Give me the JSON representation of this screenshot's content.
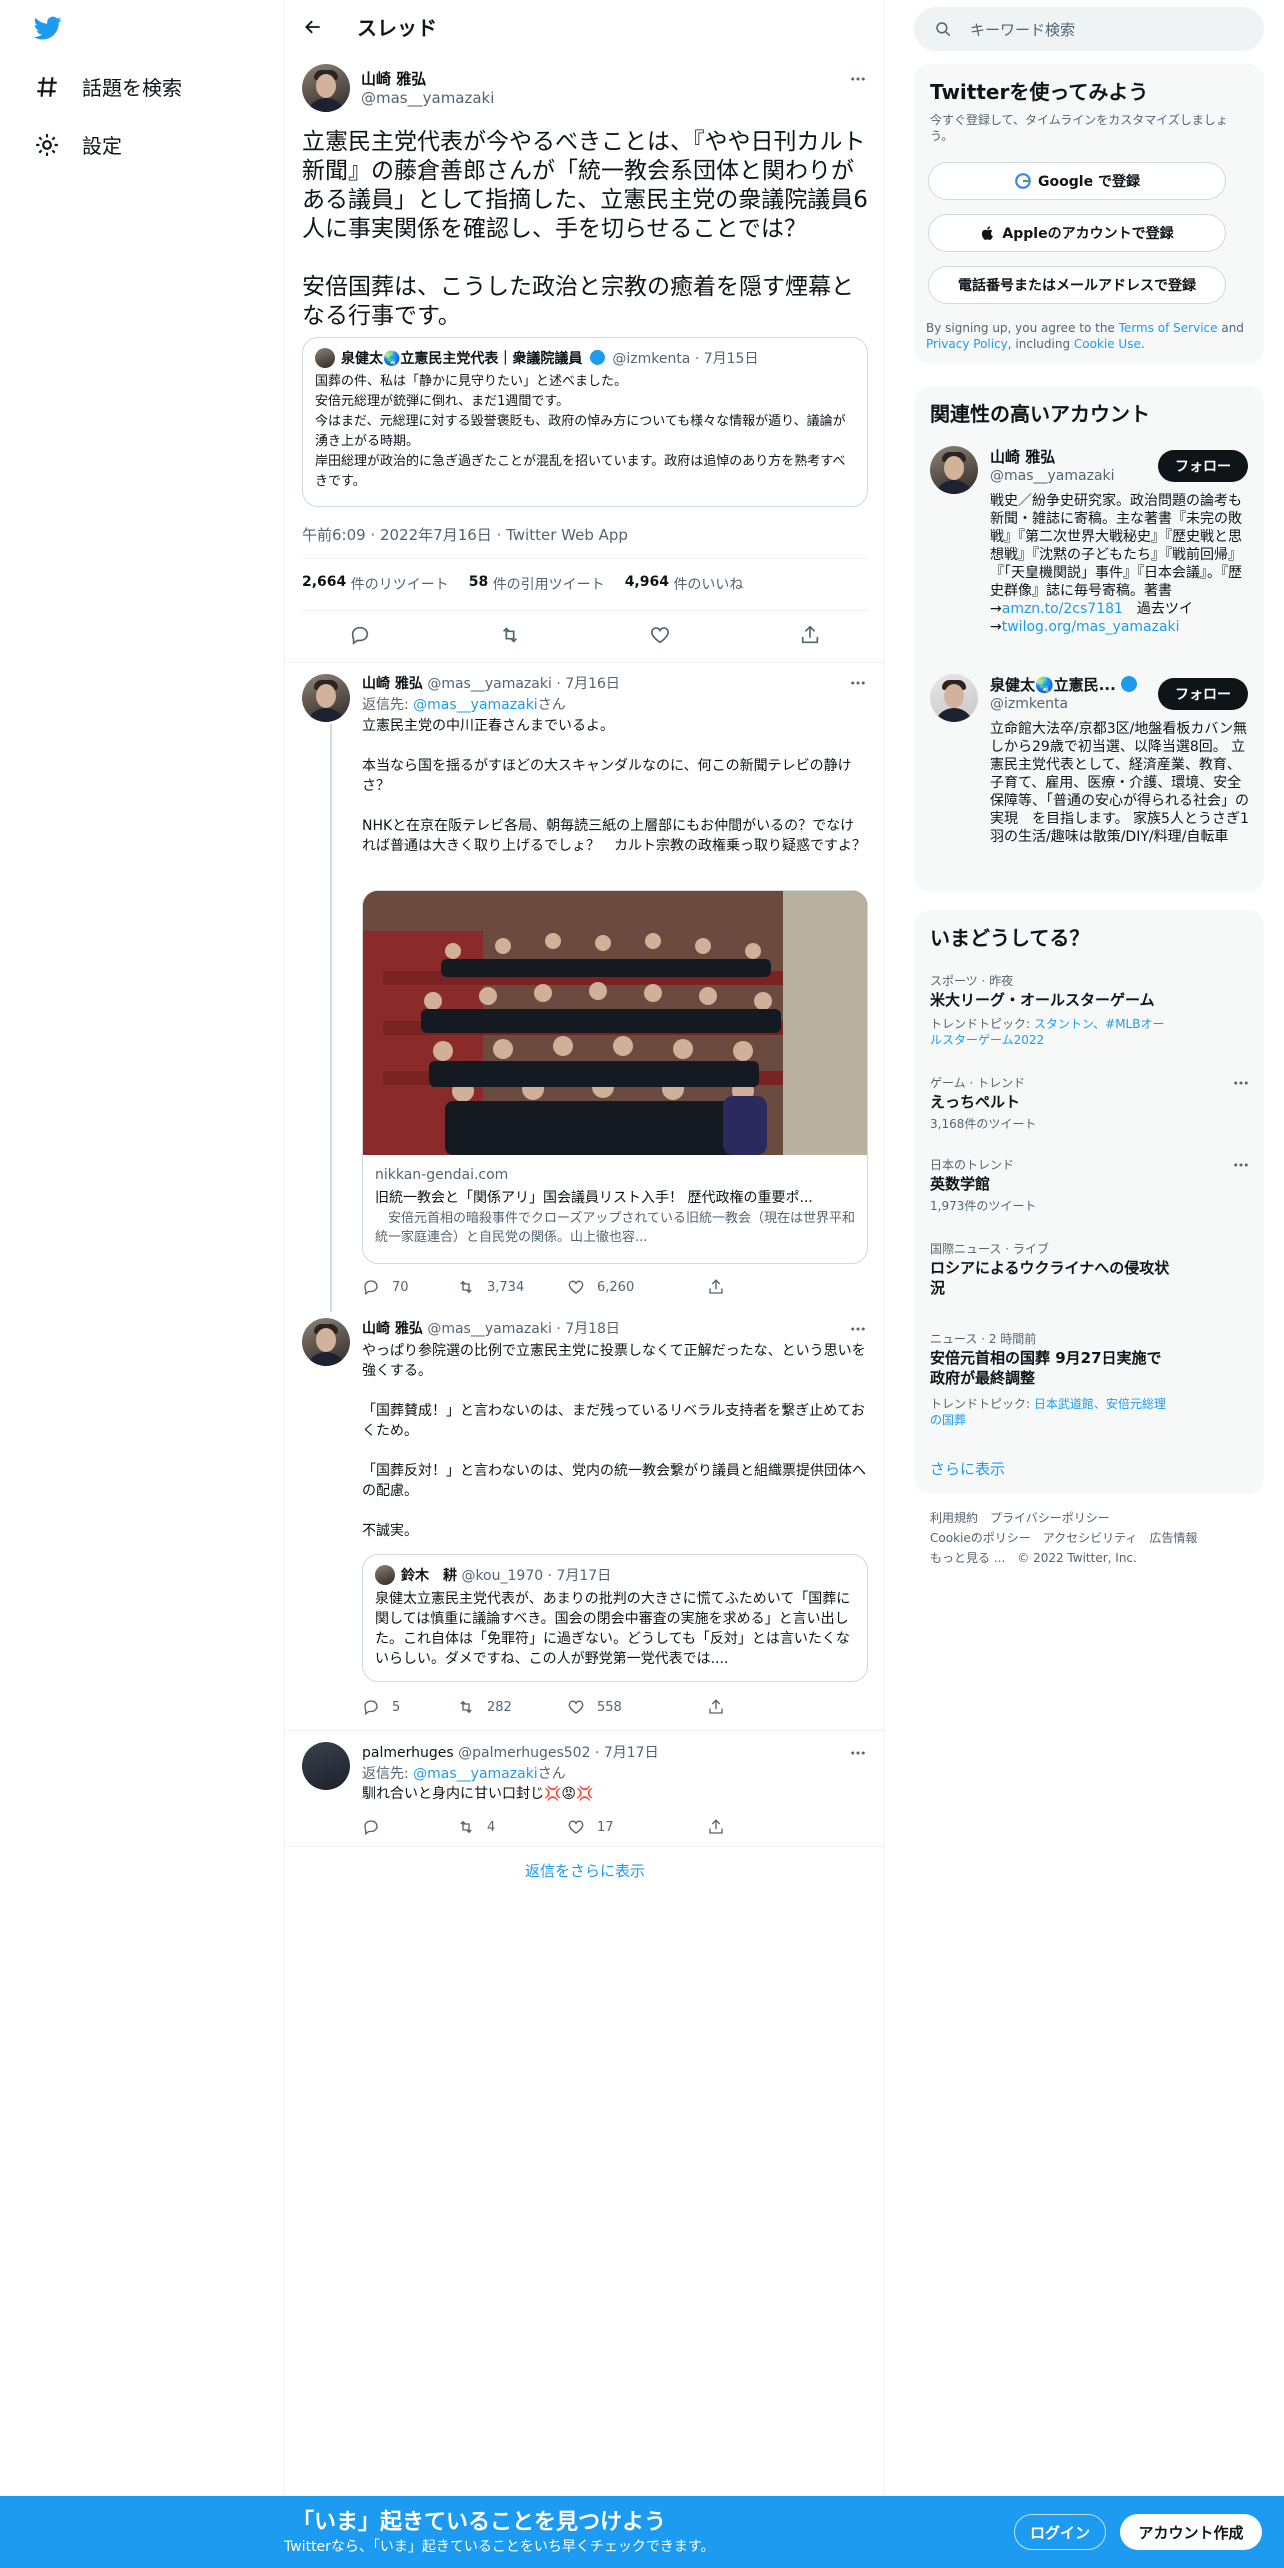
{
  "nav": {
    "explore_label": "話題を検索",
    "settings_label": "設定"
  },
  "header": {
    "title": "スレッド"
  },
  "main_tweet": {
    "name": "山崎 雅弘",
    "handle": "@mas__yamazaki",
    "text": "立憲民主党代表が今やるべきことは、『やや日刊カルト新聞』の藤倉善郎さんが「統一教会系団体と関わりがある議員」として指摘した、立憲民主党の衆議院議員6人に事実関係を確認し、手を切らせることでは？\n\n安倍国葬は、こうした政治と宗教の癒着を隠す煙幕となる行事です。",
    "quote": {
      "name": "泉健太🌏立憲民主党代表｜衆議院議員",
      "handle": "@izmkenta",
      "date": "· 7月15日",
      "text": "国葬の件、私は「静かに見守りたい」と述べました。\n安倍元総理が銃弾に倒れ、まだ1週間です。\n今はまだ、元総理に対する毀誉褒貶も、政府の悼み方についても様々な情報が遁り、議論が湧き上がる時期。\n岸田総理が政治的に急ぎ過ぎたことが混乱を招いています。政府は追悼のあり方を熟考すべきです。"
    },
    "timestamp": "午前6:09 · 2022年7月16日 · Twitter Web App",
    "retweets": "2,664",
    "retweets_label": "件のリツイート",
    "quotes": "58",
    "quotes_label": "件の引用ツイート",
    "likes": "4,964",
    "likes_label": "件のいいね"
  },
  "reply1": {
    "name": "山崎 雅弘",
    "handle": "@mas__yamazaki",
    "date": "· 7月16日",
    "reply_to_prefix": "返信先: ",
    "reply_to_handle": "@mas__yamazaki",
    "reply_to_suffix": "さん",
    "text": "立憲民主党の中川正春さんまでいるよ。\n\n本当なら国を揺るがすほどの大スキャンダルなのに、何この新聞テレビの静けさ？\n\nNHKと在京在阪テレビ各局、朝毎読三紙の上層部にもお仲間がいるの？でなければ普通は大きく取り上げるでしょ？　カルト宗教の政権乗っ取り疑惑ですよ？",
    "card_domain": "nikkan-gendai.com",
    "card_title": "旧統一教会と「関係アリ」国会議員リスト入手！ 歴代政権の重要ポ...",
    "card_desc": "　安倍元首相の暗殺事件でクローズアップされている旧統一教会（現在は世界平和統一家庭連合）と自民党の関係。山上徹也容...",
    "replies": "70",
    "retweets": "3,734",
    "likes": "6,260"
  },
  "reply2": {
    "name": "山崎 雅弘",
    "handle": "@mas__yamazaki",
    "date": "· 7月18日",
    "text": "やっぱり参院選の比例で立憲民主党に投票しなくて正解だったな、という思いを強くする。\n\n「国葬賛成！」と言わないのは、まだ残っているリベラル支持者を繋ぎ止めておくため。\n\n「国葬反対！」と言わないのは、党内の統一教会繋がり議員と組織票提供団体への配慮。\n\n不誠実。",
    "quote": {
      "name": "鈴木　耕",
      "handle": "@kou_1970",
      "date": "· 7月17日",
      "text": "泉健太立憲民主党代表が、あまりの批判の大きさに慌てふためいて「国葬に関しては慎重に議論すべき。国会の閉会中審査の実施を求める」と言い出した。これ自体は「免罪符」に過ぎない。どうしても「反対」とは言いたくないらしい。ダメですね、この人が野党第一党代表では...."
    },
    "replies": "5",
    "retweets": "282",
    "likes": "558"
  },
  "reply3": {
    "name": "palmerhuges",
    "handle": "@palmerhuges502",
    "date": "· 7月17日",
    "reply_to_prefix": "返信先: ",
    "reply_to_handle": "@mas__yamazaki",
    "reply_to_suffix": "さん",
    "text": "馴れ合いと身内に甘い口封じ💢😡💢",
    "retweets": "4",
    "likes": "17"
  },
  "show_more_replies": "返信をさらに表示",
  "sidebar": {
    "search_placeholder": "キーワード検索",
    "signup_panel": {
      "title": "Twitterを使ってみよう",
      "subtitle": "今すぐ登録して、タイムラインをカスタマイズしましょう。",
      "google_label": "Google で登録",
      "apple_label": "Appleのアカウントで登録",
      "phone_label": "電話番号またはメールアドレスで登録",
      "terms_prefix": "By signing up, you agree to the ",
      "terms_link": "Terms of Service",
      "terms_and": " and ",
      "privacy_link": "Privacy Policy",
      "terms_including": ", including ",
      "cookie_link": "Cookie Use",
      "terms_end": "."
    },
    "related": {
      "title": "関連性の高いアカウント",
      "accounts": [
        {
          "name": "山崎 雅弘",
          "handle": "@mas__yamazaki",
          "follow_label": "フォロー",
          "bio": "戦史／紛争史研究家。政治問題の論考も新聞・雑誌に寄稿。主な著書『未完の敗戦』『第二次世界大戦秘史』『歴史戦と思想戦』『沈黙の子どもたち』『戦前回帰』『「天皇機関説」事件』『日本会議』。『歴史群像』誌に毎号寄稿。著書→",
          "bio_link1": "amzn.to/2cs7181",
          "bio_mid": "　過去ツイ→",
          "bio_link2": "twilog.org/mas_yamazaki"
        },
        {
          "name": "泉健太🌏立憲民...",
          "handle": "@izmkenta",
          "follow_label": "フォロー",
          "bio": "立命館大法卒/京都3区/地盤看板カバン無しから29歳で初当選、以降当選8回。 立憲民主党代表として、経済産業、教育、子育て、雇用、医療・介護、環境、安全保障等、「普通の安心が得られる社会」の実現　を目指します。 家族5人とうさぎ1羽の生活/趣味は散策/DIY/料理/自転車"
        }
      ]
    },
    "trends": {
      "title": "いまどうしてる？",
      "items": [
        {
          "meta": "スポーツ · 昨夜",
          "name": "米大リーグ・オールスターゲーム",
          "sub_prefix": "トレンドトピック: ",
          "sub_links": "スタントン、#MLBオールスターゲーム2022"
        },
        {
          "meta": "ゲーム · トレンド",
          "name": "えっちペルト",
          "sub": "3,168件のツイート"
        },
        {
          "meta": "日本のトレンド",
          "name": "英数学館",
          "sub": "1,973件のツイート"
        },
        {
          "meta": "国際ニュース · ライブ",
          "name": "ロシアによるウクライナへの侵攻状況"
        },
        {
          "meta": "ニュース · 2 時間前",
          "name": "安倍元首相の国葬 9月27日実施で政府が最終調整",
          "sub_prefix": "トレンドトピック: ",
          "sub_links": "日本武道館、安倍元総理の国葬"
        }
      ],
      "show_more": "さらに表示"
    },
    "footer": {
      "line1": "利用規約　プライバシーポリシー",
      "line2": "Cookieのポリシー　アクセシビリティ　広告情報",
      "line3": "もっと見る ...　© 2022 Twitter, Inc."
    }
  },
  "bottom_bar": {
    "title": "「いま」起きていることを見つけよう",
    "subtitle": "Twitterなら、「いま」起きていることをいち早くチェックできます。",
    "login_label": "ログイン",
    "signup_label": "アカウント作成"
  },
  "colors": {
    "accent": "#1d9bf0",
    "text": "#0f1419",
    "secondary": "#536471",
    "border": "#eff3f4",
    "panel": "#f7f9f9",
    "bottom_bar": "#1d9bf0"
  }
}
